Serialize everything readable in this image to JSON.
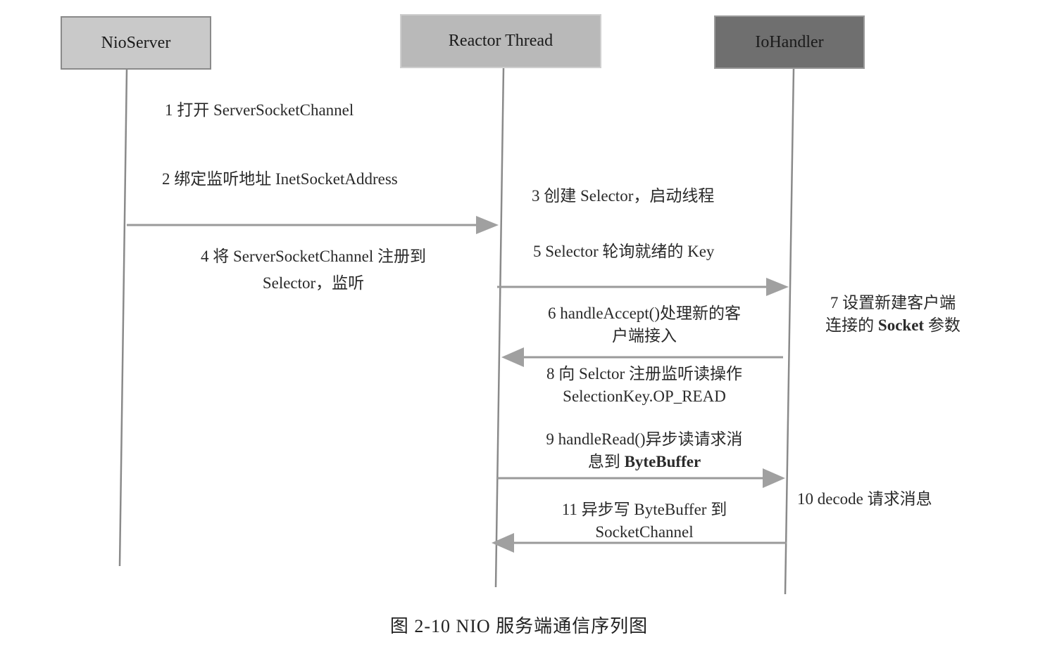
{
  "actors": [
    {
      "name": "NioServer"
    },
    {
      "name": "Reactor Thread"
    },
    {
      "name": "IoHandler"
    }
  ],
  "colors": {
    "nioserver_fill": "#c9c9c9",
    "reactor_fill": "#b9b9b9",
    "iohandler_fill": "#6f6f6f",
    "lifeline": "#8a8a8a",
    "arrow": "#9a9a9a"
  },
  "steps": {
    "s1": "1  打开  ServerSocketChannel",
    "s2": "2  绑定监听地址 InetSocketAddress",
    "s3": "3  创建 Selector，启动线程",
    "s4_line1": "4  将  ServerSocketChannel  注册到",
    "s4_line2": "Selector，监听",
    "s5": "5 Selector 轮询就绪的 Key",
    "s6_line1": "6 handleAccept()处理新的客",
    "s6_line2": "户端接入",
    "s7_line1": "7  设置新建客户端",
    "s7_line2_pre": "连接的 ",
    "s7_line2_bold": "Socket",
    "s7_line2_post": " 参数",
    "s8_line1": "8  向 Selctor 注册监听读操作",
    "s8_line2": "SelectionKey.OP_READ",
    "s9_line1": "9 handleRead()异步读请求消",
    "s9_line2_pre": "息到 ",
    "s9_line2_bold": "ByteBuffer",
    "s10": "10 decode  请求消息",
    "s11_line1": "11  异步写 ByteBuffer 到",
    "s11_line2": "SocketChannel"
  },
  "messages": [
    {
      "from": "NioServer",
      "to": "Reactor Thread",
      "direction": "right"
    },
    {
      "from": "Reactor Thread",
      "to": "IoHandler",
      "direction": "right"
    },
    {
      "from": "IoHandler",
      "to": "Reactor Thread",
      "direction": "left"
    },
    {
      "from": "Reactor Thread",
      "to": "IoHandler",
      "direction": "right"
    },
    {
      "from": "IoHandler",
      "to": "Reactor Thread",
      "direction": "left"
    }
  ],
  "caption": "图 2-10    NIO 服务端通信序列图"
}
